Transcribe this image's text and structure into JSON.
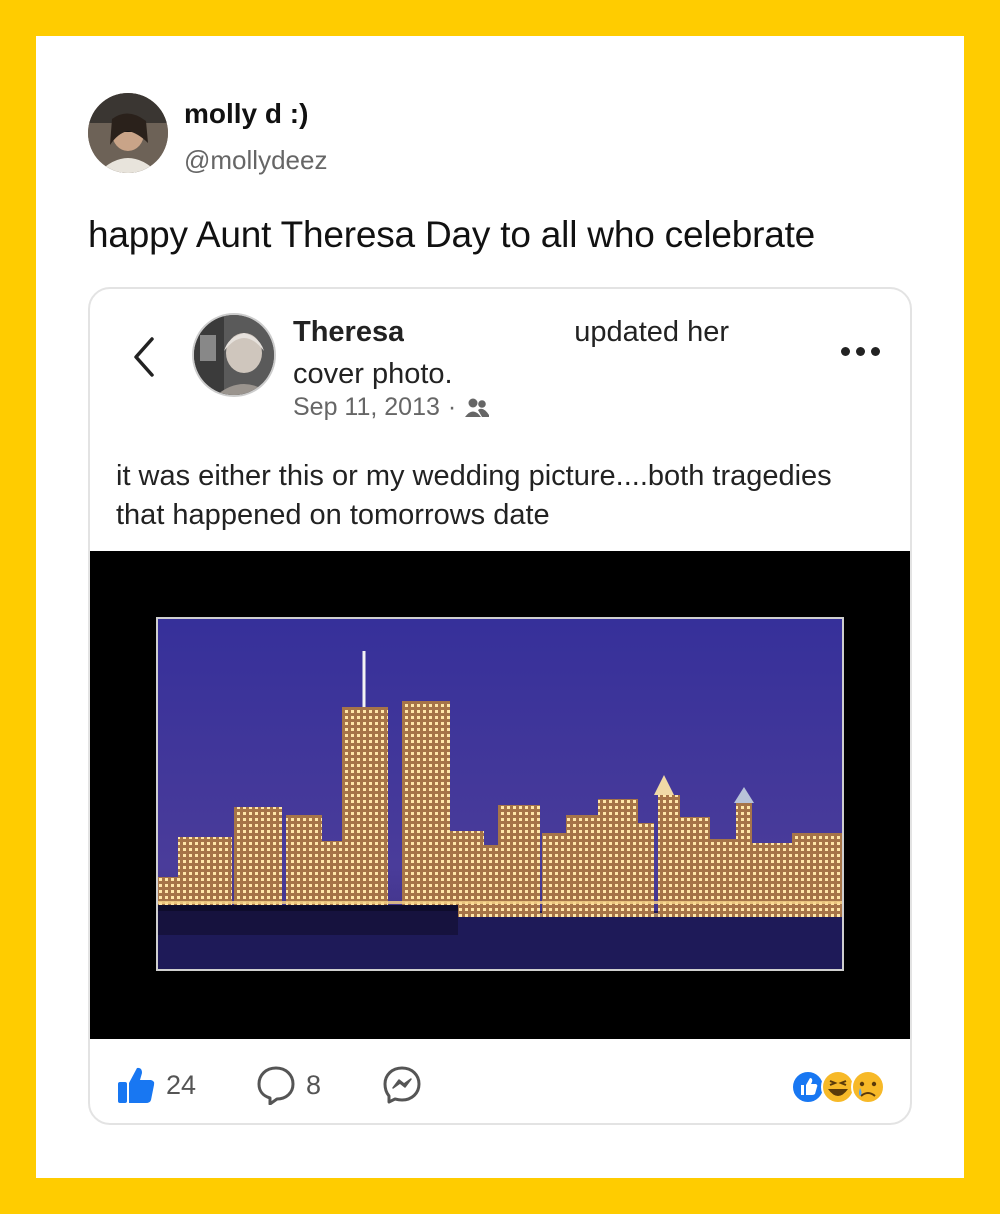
{
  "tweet": {
    "name": "molly d :)",
    "handle": "@mollydeez",
    "text": "happy Aunt Theresa Day to all who celebrate"
  },
  "fb_post": {
    "name_visible": "Theresa",
    "action_visible": "updated her",
    "action_line2": "cover photo.",
    "date": "Sep 11, 2013",
    "audience_icon": "friends-icon",
    "caption": "it was either this or my wedding picture....both tragedies that happened on tomorrows date",
    "likes_count": "24",
    "comments_count": "8",
    "reactions": [
      "like",
      "haha",
      "sad"
    ],
    "colors": {
      "like_blue": "#1877F2",
      "page_yellow": "#FFCC00"
    }
  }
}
